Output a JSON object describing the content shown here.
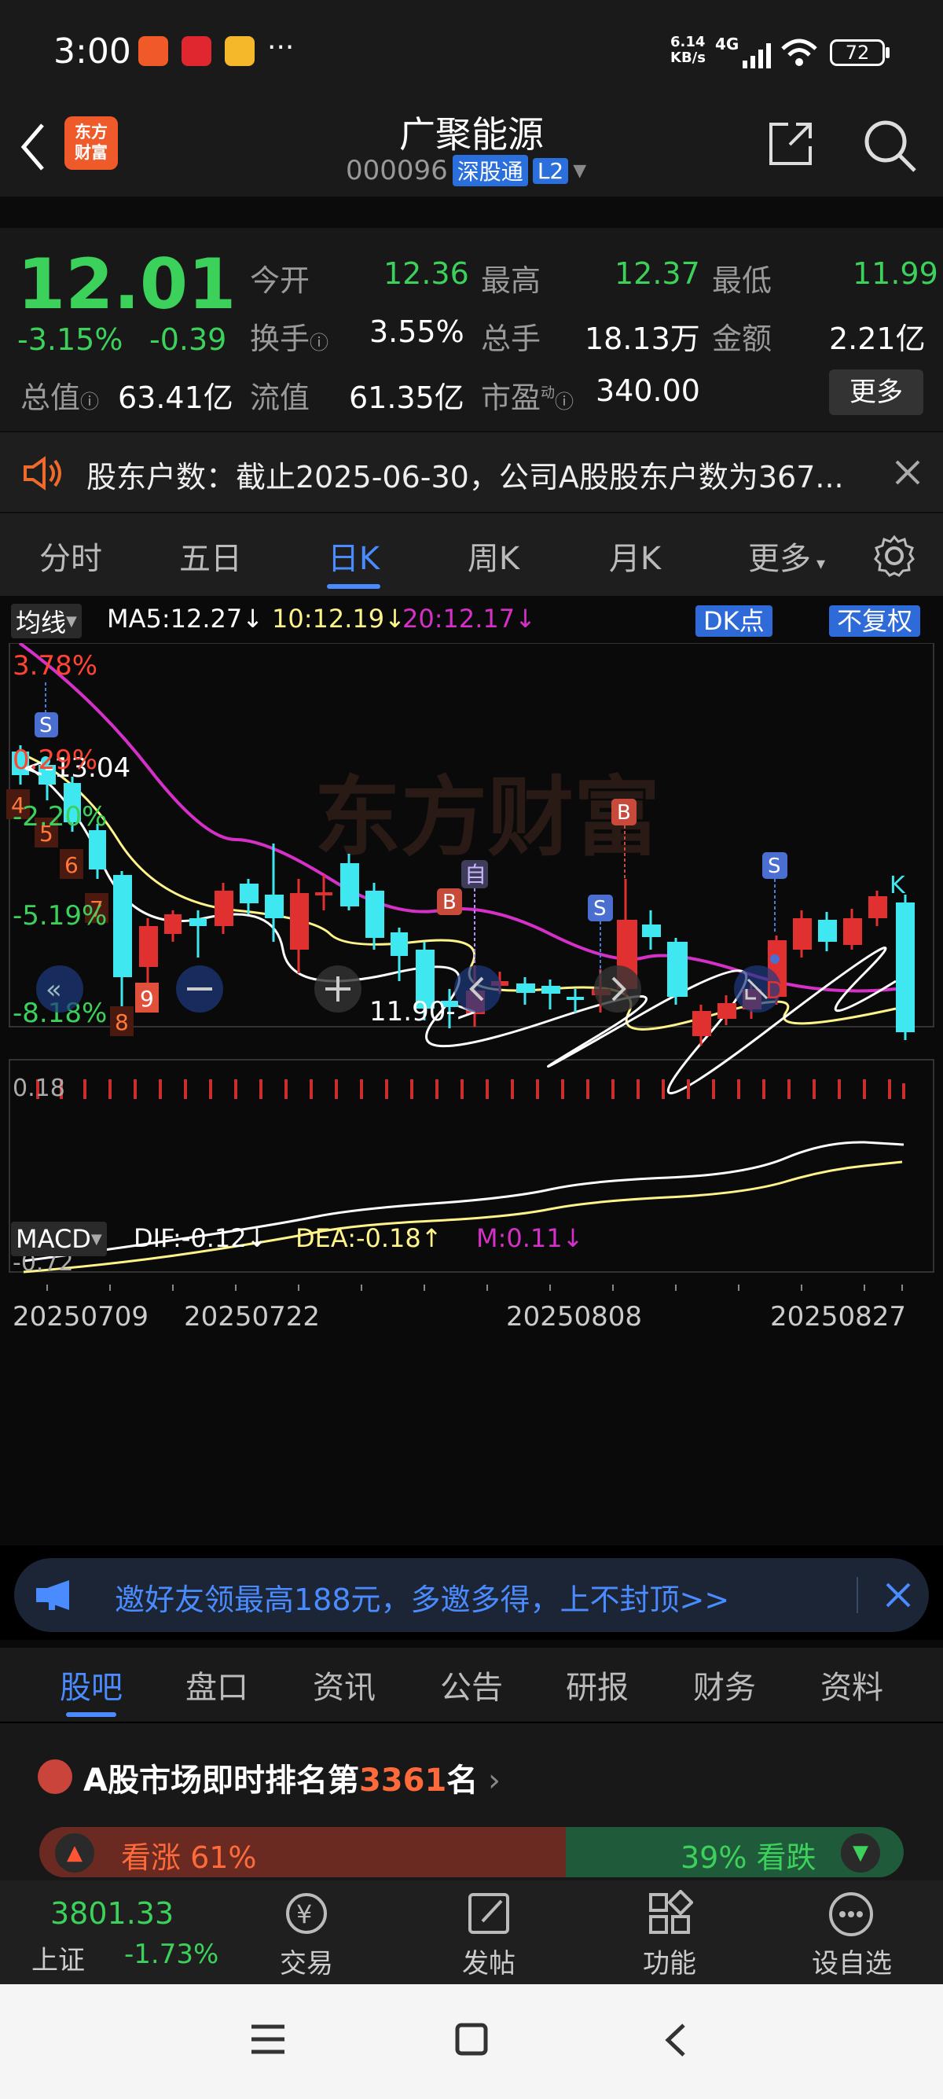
{
  "status_bar": {
    "time": "3:00",
    "net_speed_top": "6.14",
    "net_speed_bottom": "KB/s",
    "network": "4G",
    "battery": "72",
    "more": "···"
  },
  "header": {
    "logo_line1": "东方",
    "logo_line2": "财富",
    "title": "广聚能源",
    "code": "000096",
    "badge": "深股通",
    "level": "L2"
  },
  "quote": {
    "price": "12.01",
    "change_pct": "-3.15%",
    "change": "-0.39",
    "open_label": "今开",
    "open": "12.36",
    "high_label": "最高",
    "high": "12.37",
    "low_label": "最低",
    "low": "11.99",
    "turnover_label": "换手",
    "turnover": "3.55%",
    "volume_label": "总手",
    "volume": "18.13万",
    "amount_label": "金额",
    "amount": "2.21亿",
    "mktcap_label": "总值",
    "mktcap": "63.41亿",
    "float_label": "流值",
    "float": "61.35亿",
    "pe_label": "市盈",
    "pe_sup": "动",
    "pe": "340.00",
    "more_label": "更多"
  },
  "notice": {
    "text": "股东户数：截止2025-06-30，公司A股股东户数为367..."
  },
  "ktabs": {
    "items": [
      "分时",
      "五日",
      "日K",
      "周K",
      "月K",
      "更多"
    ],
    "active": 2
  },
  "indicators": {
    "ma_selector": "均线",
    "ma5": "MA5:12.27",
    "ma10": "10:12.19",
    "ma20": "20:12.17",
    "dk": "DK点",
    "fq": "不复权",
    "macd_selector": "MACD",
    "dif": "DIF:-0.12",
    "dea": "DEA:-0.18",
    "m": "M:0.11"
  },
  "kchart": {
    "pct_labels": [
      "3.78%",
      "0.29%",
      "-2.20%",
      "-5.19%",
      "-8.18%"
    ],
    "annot_high": "<-13.04",
    "annot_low": "11.90->",
    "macd_top": "0.18",
    "macd_bottom": "-0.72",
    "dates": [
      "20250709",
      "20250722",
      "20250808",
      "20250827"
    ],
    "nums": [
      "4",
      "5",
      "6",
      "7",
      "8",
      "9"
    ],
    "self_label": "自",
    "k_label": "K",
    "watermark": "东方财富",
    "d_label": "D",
    "marks": {
      "s": "S",
      "b": "B"
    }
  },
  "banner": {
    "text": "邀好友领最高188元，多邀多得，上不封顶>>"
  },
  "bottom_tabs": {
    "items": [
      "股吧",
      "盘口",
      "资讯",
      "公告",
      "研报",
      "财务",
      "资料"
    ],
    "active": 0
  },
  "rank": {
    "prefix": "A股市场即时排名第",
    "rank": "3361",
    "suffix": "名",
    "up_label": "看涨 61%",
    "down_label": "39% 看跌"
  },
  "bottom_nav": {
    "index_value": "3801.33",
    "index_name": "上证",
    "index_change": "-1.73%",
    "trade": "交易",
    "post": "发帖",
    "function": "功能",
    "watchlist": "设自选"
  },
  "colors": {
    "up": "#ff4433",
    "down": "#3bd15a",
    "ma5": "#ffffff",
    "ma10": "#fff48a",
    "ma20": "#d530c7",
    "accent": "#2f6bd8",
    "cyan": "#3fe8f0"
  }
}
